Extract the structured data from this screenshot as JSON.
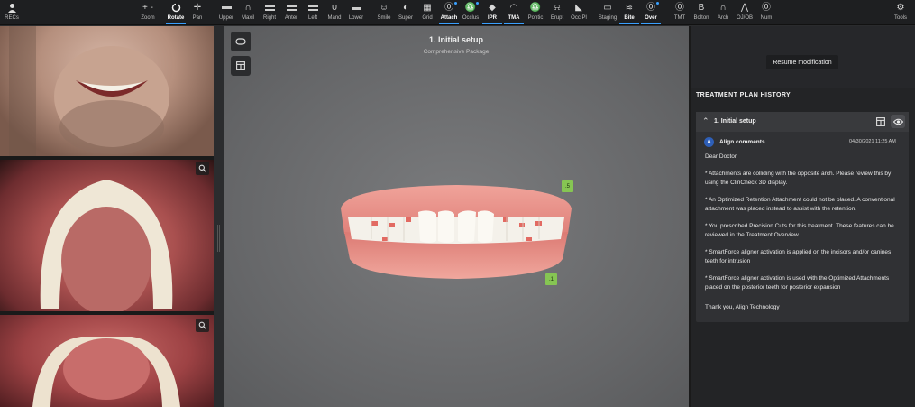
{
  "toolbar": {
    "items": [
      {
        "label": "RECs",
        "icon": "person-icon"
      },
      {
        "label": "Zoom",
        "icon": "zoom-plus-minus-icon"
      },
      {
        "label": "Rotate",
        "icon": "rotate-icon"
      },
      {
        "label": "Pan",
        "icon": "pan-icon"
      },
      {
        "label": "Upper",
        "icon": "upper-arch-icon"
      },
      {
        "label": "Maxil",
        "icon": "maxillary-icon"
      },
      {
        "label": "Right",
        "icon": "right-view-icon"
      },
      {
        "label": "Anter",
        "icon": "anterior-view-icon"
      },
      {
        "label": "Left",
        "icon": "left-view-icon"
      },
      {
        "label": "Mand",
        "icon": "mandibular-icon"
      },
      {
        "label": "Lower",
        "icon": "lower-arch-icon"
      },
      {
        "label": "Smile",
        "icon": "smile-icon"
      },
      {
        "label": "Super",
        "icon": "superimpose-icon"
      },
      {
        "label": "Grid",
        "icon": "grid-icon"
      },
      {
        "label": "Attach",
        "icon": "attachment-icon"
      },
      {
        "label": "Occlus",
        "icon": "occlusion-icon"
      },
      {
        "label": "IPR",
        "icon": "ipr-icon"
      },
      {
        "label": "TMA",
        "icon": "tma-icon"
      },
      {
        "label": "Pontic",
        "icon": "pontic-icon"
      },
      {
        "label": "Erupt",
        "icon": "erupt-icon"
      },
      {
        "label": "Occ Pl",
        "icon": "occlusal-plane-icon"
      },
      {
        "label": "Staging",
        "icon": "staging-icon"
      },
      {
        "label": "Bite",
        "icon": "bite-icon"
      },
      {
        "label": "Over",
        "icon": "overlay-icon"
      },
      {
        "label": "TMT",
        "icon": "tmt-icon"
      },
      {
        "label": "Bolton",
        "icon": "bolton-icon"
      },
      {
        "label": "Arch",
        "icon": "arch-icon"
      },
      {
        "label": "OJ/OB",
        "icon": "overjet-icon"
      },
      {
        "label": "Num",
        "icon": "numbering-icon"
      },
      {
        "label": "Tools",
        "icon": "gear-icon"
      }
    ]
  },
  "viewer": {
    "title": "1. Initial setup",
    "subtitle": "Comprehensive Package",
    "marker_upper": ".5",
    "marker_lower": ".1"
  },
  "panel": {
    "resume_button": "Resume modification",
    "history_heading": "TREATMENT PLAN HISTORY",
    "setup_title": "1. Initial setup",
    "comment": {
      "avatar_letter": "A",
      "author": "Align comments",
      "date": "04/30/2021 11:25 AM",
      "paragraphs": [
        "Dear Doctor",
        "* Attachments are colliding with the opposite arch. Please review this by using the ClinCheck 3D display.",
        "* An Optimized Retention Attachment could not be placed. A conventional attachment was placed instead to assist with the retention.",
        "* You prescribed Precision Cuts for this treatment. These features can be reviewed in the Treatment Overview.",
        "* SmartForce aligner activation is applied on the incisors and/or canines teeth for intrusion",
        "* SmartForce aligner activation is used with the Optimized Attachments placed on the posterior teeth for posterior expansion",
        "Thank you, Align Technology"
      ]
    }
  },
  "colors": {
    "accent": "#3aa0ff",
    "marker": "#86c553",
    "panel_bg": "#232426",
    "viewer_bg": "#6b6c6e"
  }
}
